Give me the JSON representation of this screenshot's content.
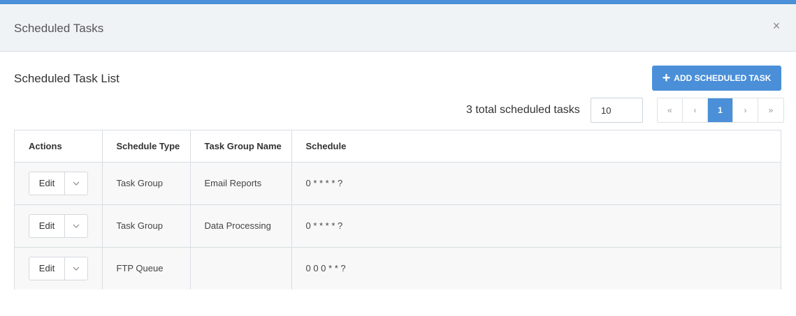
{
  "modal": {
    "title": "Scheduled Tasks",
    "close_label": "×"
  },
  "section": {
    "title": "Scheduled Task List",
    "add_button_label": "ADD SCHEDULED TASK"
  },
  "summary": {
    "total_text": "3 total scheduled tasks",
    "page_size": "10"
  },
  "pagination": {
    "first": "«",
    "prev": "‹",
    "current": "1",
    "next": "›",
    "last": "»"
  },
  "table": {
    "headers": [
      "Actions",
      "Schedule Type",
      "Task Group Name",
      "Schedule"
    ],
    "rows": [
      {
        "edit_label": "Edit",
        "schedule_type": "Task Group",
        "task_group_name": "Email Reports",
        "schedule": "0 * * * * ?"
      },
      {
        "edit_label": "Edit",
        "schedule_type": "Task Group",
        "task_group_name": "Data Processing",
        "schedule": "0 * * * * ?"
      },
      {
        "edit_label": "Edit",
        "schedule_type": "FTP Queue",
        "task_group_name": "",
        "schedule": "0 0 0 * * ?"
      }
    ]
  },
  "colors": {
    "accent": "#4a8fd8",
    "header_bg": "#f0f3f6",
    "row_bg": "#f8f8f8"
  },
  "icons": {
    "close": "close-icon",
    "add": "plus-icon",
    "dropdown": "chevron-down-icon"
  }
}
